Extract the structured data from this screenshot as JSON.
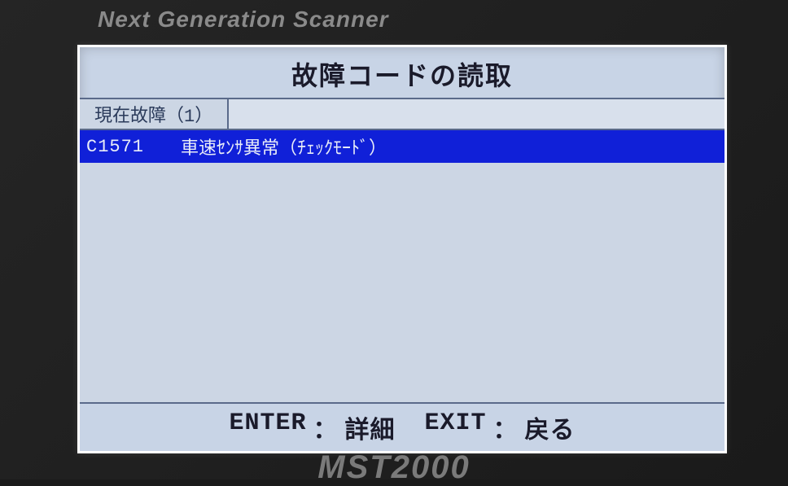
{
  "device": {
    "brand_top": "Next Generation Scanner",
    "brand_bottom": "MST2000"
  },
  "screen": {
    "title": "故障コードの読取"
  },
  "tabs": [
    {
      "label": "現在故障（1）"
    }
  ],
  "dtc_list": [
    {
      "code": "C1571",
      "description": "車速ｾﾝｻ異常（ﾁｪｯｸﾓｰﾄﾞ）"
    }
  ],
  "footer": {
    "enter_key": "ENTER",
    "enter_label": "詳細",
    "exit_key": "EXIT",
    "exit_label": "戻る",
    "separator": "："
  }
}
